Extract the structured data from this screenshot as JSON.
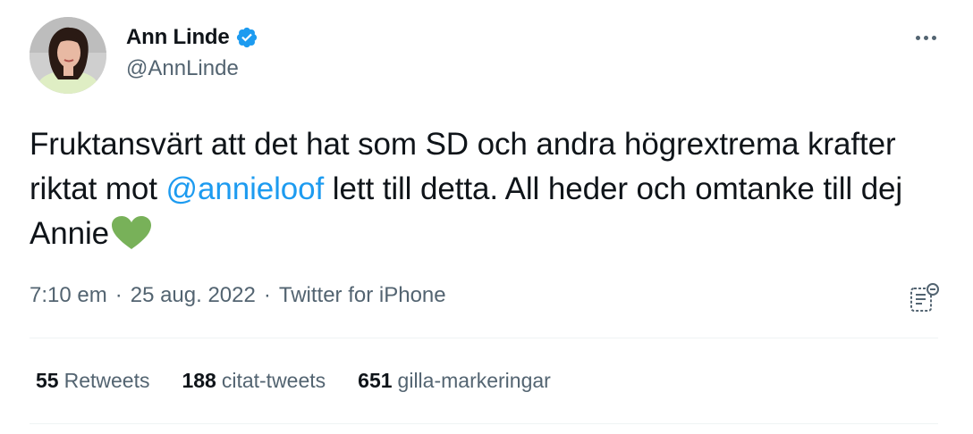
{
  "author": {
    "display_name": "Ann Linde",
    "handle": "@AnnLinde",
    "verified": true
  },
  "tweet": {
    "text_part1": "Fruktansvärt att det hat som SD och andra högrextrema krafter riktat mot ",
    "mention": "@annieloof",
    "text_part2": " lett till detta. All heder och omtanke till dej Annie",
    "emoji": "green-heart"
  },
  "meta": {
    "time": "7:10 em",
    "separator": "·",
    "date": "25 aug. 2022",
    "source": "Twitter for iPhone"
  },
  "stats": {
    "retweets_count": "55",
    "retweets_label": "Retweets",
    "quotes_count": "188",
    "quotes_label": "citat-tweets",
    "likes_count": "651",
    "likes_label": "gilla-markeringar"
  },
  "icons": {
    "verified": "verified-badge-icon",
    "more": "more-options-icon",
    "analytics": "tweet-analytics-icon"
  },
  "colors": {
    "link": "#1d9bf0",
    "text": "#0f1419",
    "secondary": "#536471",
    "heart": "#78b159",
    "verified": "#1d9bf0"
  }
}
